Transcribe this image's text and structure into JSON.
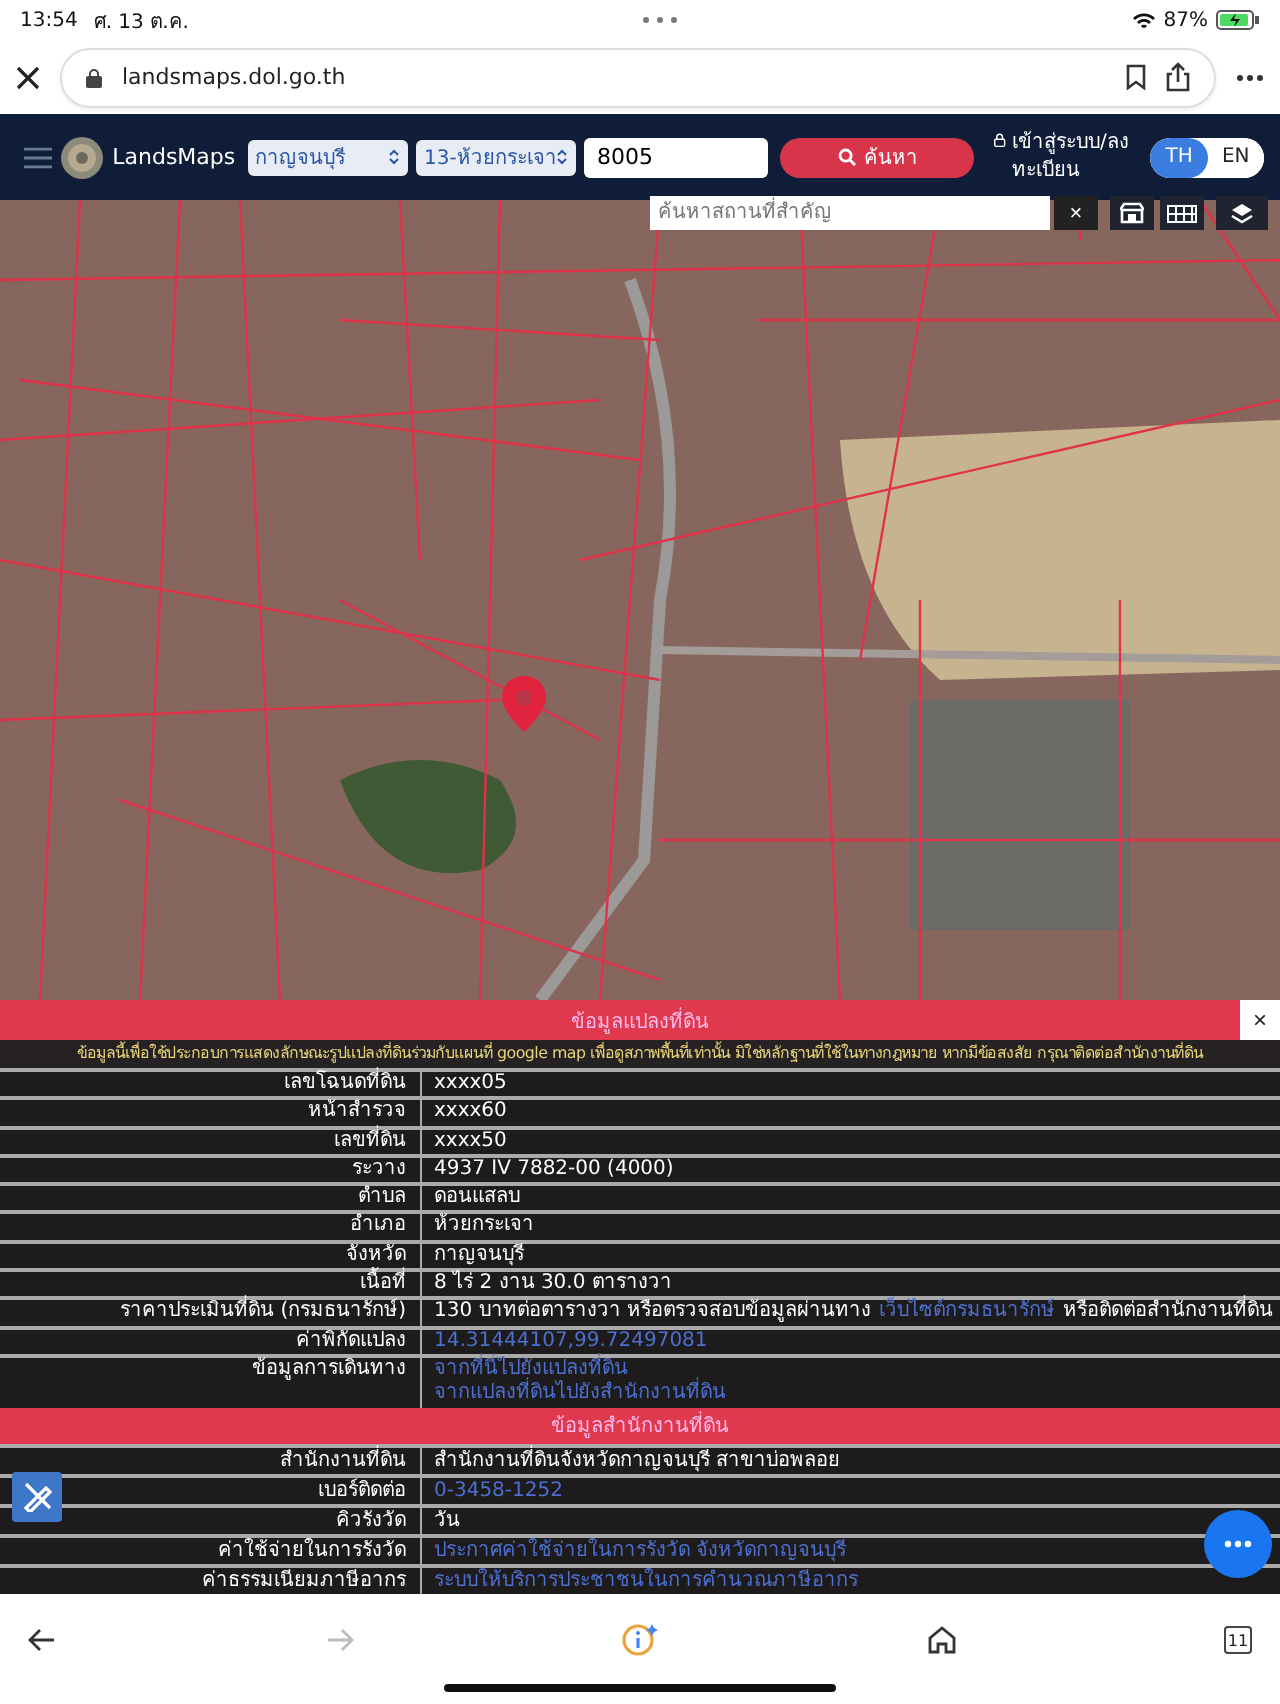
{
  "status_bar": {
    "time": "13:54",
    "date": "ศ. 13 ต.ค.",
    "battery": "87%"
  },
  "browser": {
    "url": "landsmaps.dol.go.th",
    "forward_disabled": true,
    "tab_count": "11"
  },
  "header": {
    "logo": "LandsMaps",
    "province": "กาญจนบุรี",
    "district": "13-ห้วยกระเจา",
    "parcel_number": "8005",
    "search_button": "ค้นหา",
    "login": "เข้าสู่ระบบ/ลงทะเบียน",
    "languages": [
      {
        "label": "TH",
        "selected": true
      },
      {
        "label": "EN",
        "selected": false
      }
    ]
  },
  "map": {
    "search_placeholder": "ค้นหาสถานที่สำคัญ",
    "clear": "×"
  },
  "parcel_panel": {
    "title": "ข้อมูลแปลงที่ดิน",
    "close": "×",
    "notice": "ข้อมูลนี้เพื่อใช้ประกอบการแสดงลักษณะรูปแปลงที่ดินร่วมกับแผนที่ google map เพื่อดูสภาพพื้นที่เท่านั้น มิใช่หลักฐานที่ใช้ในทางกฎหมาย หากมีข้อสงสัย กรุณาติดต่อสำนักงานที่ดิน",
    "rows": [
      {
        "label": "เลขโฉนดที่ดิน",
        "lines": [
          [
            {
              "kind": "text",
              "text": "xxxx05"
            }
          ]
        ]
      },
      {
        "label": "หน้าสำรวจ",
        "lines": [
          [
            {
              "kind": "text",
              "text": "xxxx60"
            }
          ]
        ]
      },
      {
        "label": "เลขที่ดิน",
        "lines": [
          [
            {
              "kind": "text",
              "text": "xxxx50"
            }
          ]
        ]
      },
      {
        "label": "ระวาง",
        "lines": [
          [
            {
              "kind": "text",
              "text": "4937 IV 7882-00 (4000)"
            }
          ]
        ]
      },
      {
        "label": "ตำบล",
        "lines": [
          [
            {
              "kind": "text",
              "text": "ดอนแสลบ"
            }
          ]
        ]
      },
      {
        "label": "อำเภอ",
        "lines": [
          [
            {
              "kind": "text",
              "text": "ห้วยกระเจา"
            }
          ]
        ]
      },
      {
        "label": "จังหวัด",
        "lines": [
          [
            {
              "kind": "text",
              "text": "กาญจนบุรี"
            }
          ]
        ]
      },
      {
        "label": "เนื้อที่",
        "lines": [
          [
            {
              "kind": "text",
              "text": "8 ไร่ 2 งาน 30.0 ตารางวา"
            }
          ]
        ]
      },
      {
        "label": "ราคาประเมินที่ดิน (กรมธนารักษ์)",
        "lines": [
          [
            {
              "kind": "text",
              "text": "130 บาทต่อตารางวา หรือตรวจสอบข้อมูลผ่านทาง"
            },
            {
              "kind": "link",
              "text": "เว็บไซต์กรมธนารักษ์"
            },
            {
              "kind": "text",
              "text": "หรือติดต่อสำนักงานที่ดิน"
            }
          ]
        ]
      },
      {
        "label": "ค่าพิกัดแปลง",
        "lines": [
          [
            {
              "kind": "link",
              "text": "14.31444107,99.72497081"
            }
          ]
        ]
      },
      {
        "label": "ข้อมูลการเดินทาง",
        "lines": [
          [
            {
              "kind": "link",
              "text": "จากที่นี่ไปยังแปลงที่ดิน"
            }
          ],
          [
            {
              "kind": "link",
              "text": "จากแปลงที่ดินไปยังสำนักงานที่ดิน"
            }
          ]
        ]
      }
    ]
  },
  "office_panel": {
    "title": "ข้อมูลสำนักงานที่ดิน",
    "rows": [
      {
        "label": "สำนักงานที่ดิน",
        "lines": [
          [
            {
              "kind": "text",
              "text": "สำนักงานที่ดินจังหวัดกาญจนบุรี สาขาบ่อพลอย"
            }
          ]
        ]
      },
      {
        "label": "เบอร์ติดต่อ",
        "lines": [
          [
            {
              "kind": "link",
              "text": "0-3458-1252"
            }
          ]
        ]
      },
      {
        "label": "คิวรังวัด",
        "lines": [
          [
            {
              "kind": "text",
              "text": "วัน"
            }
          ]
        ]
      },
      {
        "label": "ค่าใช้จ่ายในการรังวัด",
        "lines": [
          [
            {
              "kind": "link",
              "text": "ประกาศค่าใช้จ่ายในการรังวัด จังหวัดกาญจนบุรี"
            }
          ]
        ]
      },
      {
        "label": "ค่าธรรมเนียมภาษีอากร",
        "lines": [
          [
            {
              "kind": "link",
              "text": "ระบบให้บริการประชาชนในการคำนวณภาษีอากร"
            }
          ]
        ]
      }
    ]
  }
}
